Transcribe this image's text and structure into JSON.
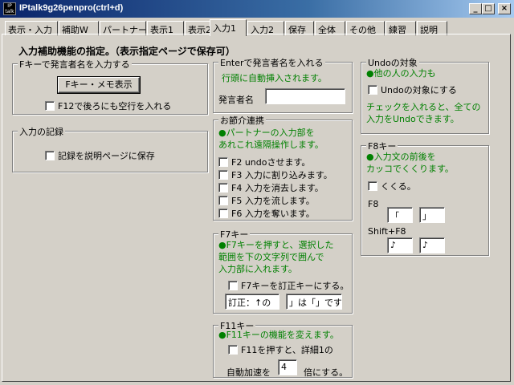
{
  "window": {
    "title": "IPtalk9g26penpro(ctrl+d)",
    "icon_text": "IP talk"
  },
  "tabs": [
    "表示・入力",
    "補助W",
    "パートナー",
    "表示1",
    "表示2",
    "入力1",
    "入力2",
    "保存",
    "全体",
    "その他",
    "練習",
    "説明"
  ],
  "heading": "入力補助機能の指定。（表示指定ページで保存可）",
  "fkey_group": {
    "title": "Fキーで発言者名を入力する",
    "button": "Fキー・メモ表示",
    "checkbox": "F12で後ろにも空行を入れる"
  },
  "record_group": {
    "title": "入力の記録",
    "checkbox": "記録を説明ページに保存"
  },
  "enter_group": {
    "title": "Enterで発言者名を入れる",
    "note": "行頭に自動挿入されます。",
    "field_label": "発言者名",
    "field_value": ""
  },
  "partner_group": {
    "title": "お節介連携",
    "note1": "●パートナーの入力部を",
    "note2": "あれこれ遠隔操作します。",
    "checks": [
      "F2 undoさせます。",
      "F3 入力に割り込みます。",
      "F4 入力を消去します。",
      "F5 入力を流します。",
      "F6 入力を奪います。"
    ]
  },
  "f7_group": {
    "title": "F7キー",
    "note1": "●F7キーを押すと、選択した",
    "note2": "範囲を下の文字列で囲んで",
    "note3": "入力部に入れます。",
    "checkbox": "F7キーを訂正キーにする。",
    "field1": "訂正：↑の",
    "field2": "」は「」です"
  },
  "f11_group": {
    "title": "F11キー",
    "note": "●F11キーの機能を変えます。",
    "checkbox": "F11を押すと、詳細1の",
    "label_before": "自動加速を",
    "value": "4",
    "label_after": "倍にする。"
  },
  "undo_group": {
    "title": "Undoの対象",
    "note": "●他の人の入力も",
    "checkbox": "Undoの対象にする",
    "note2": "チェックを入れると、全ての",
    "note3": "入力をUndoできます。"
  },
  "f8_group": {
    "title": "F8キー",
    "note1": "●入力文の前後を",
    "note2": "カッコでくくります。",
    "checkbox": "くくる。",
    "f8_label": "F8",
    "f8_open": "「",
    "f8_close": "」",
    "shift_label": "Shift+F8",
    "shift_open": "♪",
    "shift_close": "♪"
  }
}
